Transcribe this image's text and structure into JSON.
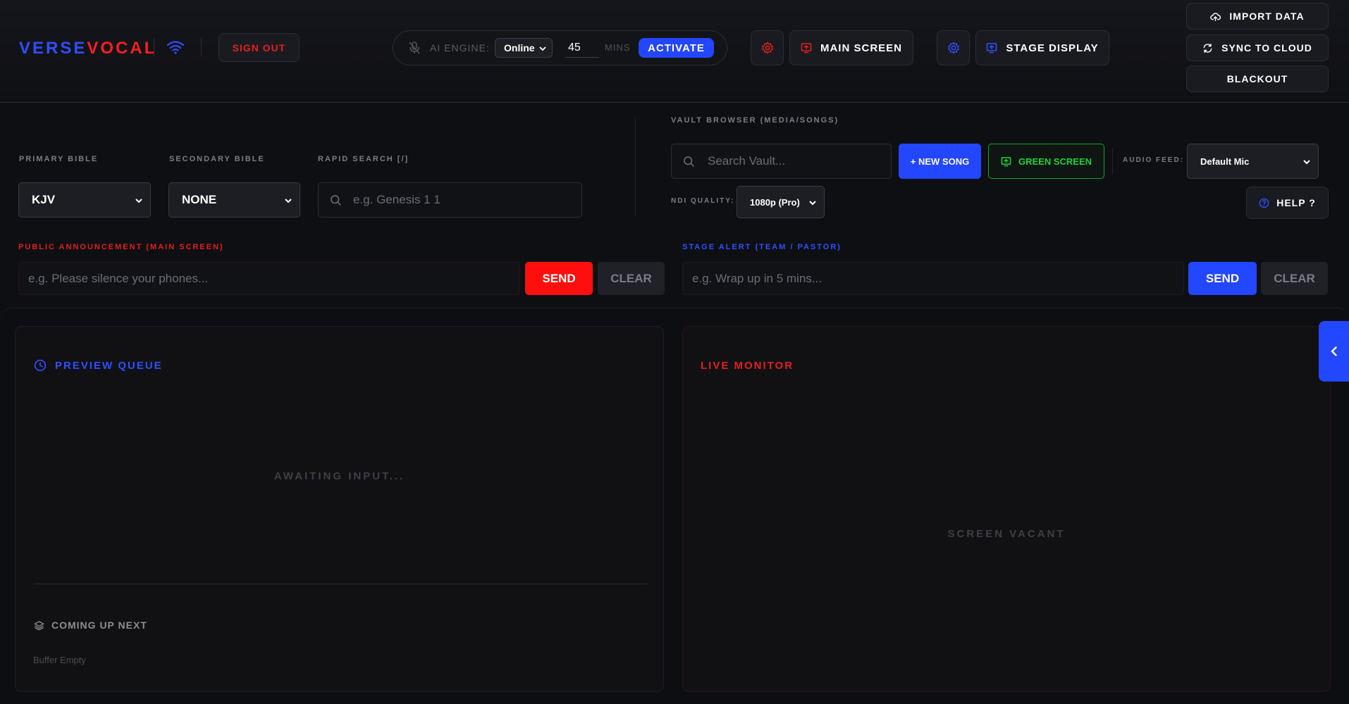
{
  "app": {
    "logo_part1": "VERSE",
    "logo_part2": "VOCAL"
  },
  "header": {
    "sign_out": "SIGN OUT",
    "ai_engine": {
      "label": "AI ENGINE:",
      "mode": "Online",
      "minutes_value": "45",
      "minutes_unit": "MINS",
      "activate": "ACTIVATE"
    },
    "main_screen": "MAIN SCREEN",
    "stage_display": "STAGE DISPLAY",
    "import_data": "IMPORT DATA",
    "sync_to_cloud": "SYNC TO CLOUD",
    "blackout": "BLACKOUT"
  },
  "bible": {
    "primary_label": "PRIMARY BIBLE",
    "primary_value": "KJV",
    "secondary_label": "SECONDARY BIBLE",
    "secondary_value": "NONE",
    "rapid_label": "RAPID SEARCH [/]",
    "rapid_placeholder": "e.g. Genesis 1 1"
  },
  "vault": {
    "label": "VAULT BROWSER (MEDIA/SONGS)",
    "search_placeholder": "Search Vault...",
    "new_song": "+ NEW SONG",
    "green_screen": "GREEN SCREEN",
    "audio_feed_label": "AUDIO FEED:",
    "audio_feed_value": "Default Mic",
    "ndi_label": "NDI QUALITY:",
    "ndi_value": "1080p (Pro)",
    "help": "HELP ?"
  },
  "announcement": {
    "label": "PUBLIC ANNOUNCEMENT (MAIN SCREEN)",
    "placeholder": "e.g. Please silence your phones...",
    "send": "SEND",
    "clear": "CLEAR"
  },
  "stage_alert": {
    "label": "STAGE ALERT (TEAM / PASTOR)",
    "placeholder": "e.g. Wrap up in 5 mins...",
    "send": "SEND",
    "clear": "CLEAR"
  },
  "preview": {
    "title": "PREVIEW QUEUE",
    "awaiting": "AWAITING INPUT...",
    "coming_up": "COMING UP NEXT",
    "buffer": "Buffer Empty"
  },
  "live": {
    "title": "LIVE MONITOR",
    "vacant": "SCREEN VACANT"
  },
  "colors": {
    "blue": "#2346ff",
    "red": "#ff0e0e",
    "green": "#1fd23a",
    "background": "#0e0f13"
  }
}
